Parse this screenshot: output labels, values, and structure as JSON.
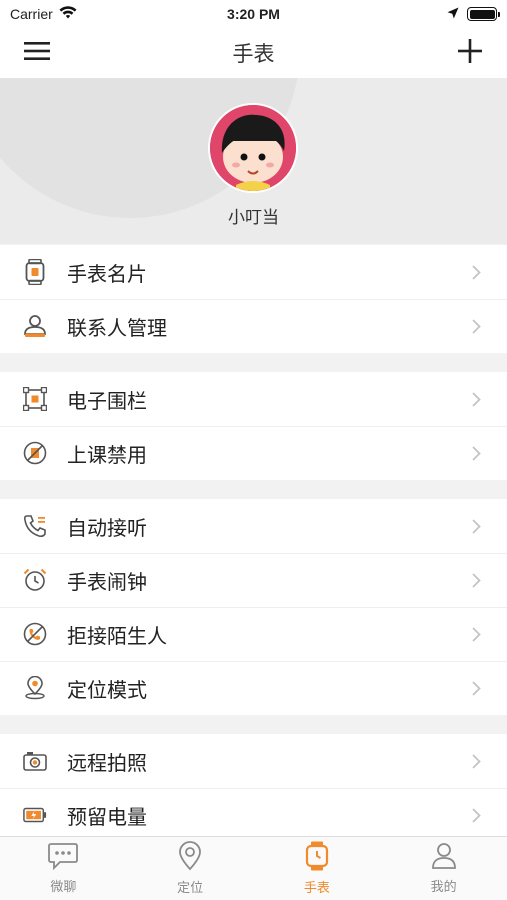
{
  "status_bar": {
    "carrier": "Carrier",
    "time": "3:20 PM",
    "battery_level": 1.0
  },
  "nav": {
    "title": "手表",
    "menu_icon": "hamburger-menu-icon",
    "add_icon": "plus-icon"
  },
  "profile": {
    "name": "小叮当",
    "avatar_color": "#e0456a"
  },
  "colors": {
    "accent": "#f08a2c",
    "icon_gray": "#555555",
    "chevron": "#c4c4c4"
  },
  "groups": [
    {
      "items": [
        {
          "label": "手表名片",
          "icon": "watch-card-icon"
        },
        {
          "label": "联系人管理",
          "icon": "contacts-icon"
        }
      ]
    },
    {
      "items": [
        {
          "label": "电子围栏",
          "icon": "geofence-icon"
        },
        {
          "label": "上课禁用",
          "icon": "class-disable-icon"
        }
      ]
    },
    {
      "items": [
        {
          "label": "自动接听",
          "icon": "auto-answer-icon"
        },
        {
          "label": "手表闹钟",
          "icon": "alarm-clock-icon"
        },
        {
          "label": "拒接陌生人",
          "icon": "reject-stranger-icon"
        },
        {
          "label": "定位模式",
          "icon": "location-mode-icon"
        }
      ]
    },
    {
      "items": [
        {
          "label": "远程拍照",
          "icon": "remote-camera-icon"
        },
        {
          "label": "预留电量",
          "icon": "battery-reserve-icon"
        }
      ]
    }
  ],
  "tabs": [
    {
      "label": "微聊",
      "icon": "chat-icon",
      "active": false
    },
    {
      "label": "定位",
      "icon": "location-icon",
      "active": false
    },
    {
      "label": "手表",
      "icon": "watch-icon",
      "active": true
    },
    {
      "label": "我的",
      "icon": "profile-icon",
      "active": false
    }
  ]
}
